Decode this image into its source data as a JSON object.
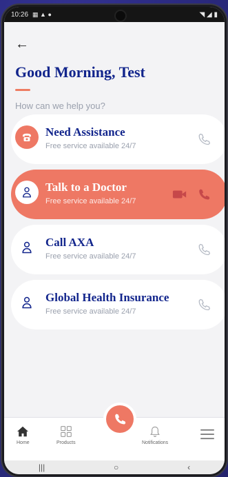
{
  "status": {
    "time": "10:26",
    "right": "◥ ◢ ▮"
  },
  "header": {
    "greeting": "Good Morning, Test",
    "subtitle": "How can we help you?"
  },
  "cards": [
    {
      "title": "Need Assistance",
      "subtitle": "Free service available 24/7",
      "icon": "telephone-icon",
      "active": false
    },
    {
      "title": "Talk to a Doctor",
      "subtitle": "Free service available 24/7",
      "icon": "doctor-icon",
      "active": true
    },
    {
      "title": "Call AXA",
      "subtitle": "Free service available 24/7",
      "icon": "doctor-icon",
      "active": false
    },
    {
      "title": "Global Health Insurance",
      "subtitle": "Free service available 24/7",
      "icon": "doctor-icon",
      "active": false
    }
  ],
  "nav": {
    "home": "Home",
    "products": "Products",
    "notifications": "Notifications"
  },
  "colors": {
    "brand": "#12258c",
    "accent": "#ee7864"
  }
}
